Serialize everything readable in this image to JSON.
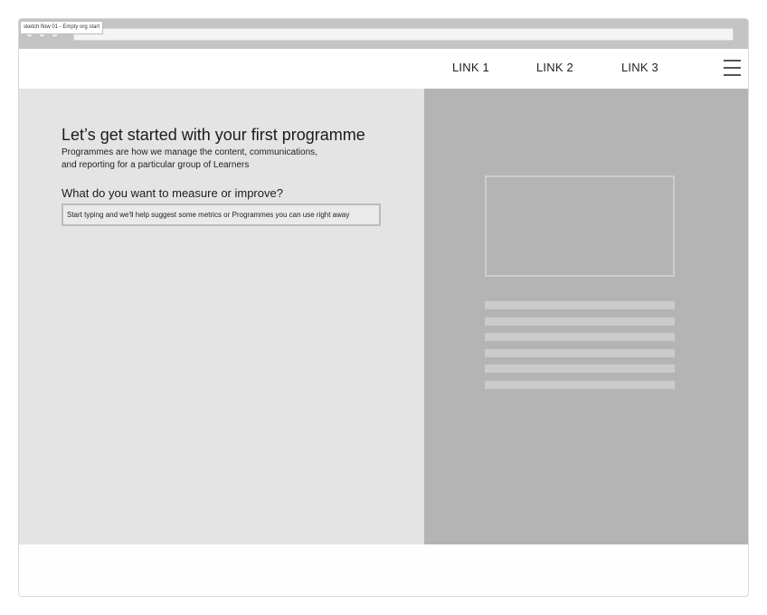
{
  "window": {
    "tab_title": "sketch flow 01 - Empty org start"
  },
  "nav": {
    "links": [
      "LINK 1",
      "LINK 2",
      "LINK 3"
    ],
    "menu_icon": "hamburger-menu-icon"
  },
  "main": {
    "heading": "Let’s get started with your first programme",
    "description": "Programmes are how we manage the content, communications, and reporting for a particular group of Learners",
    "question": "What do you want to measure or improve?",
    "search": {
      "placeholder": "Start typing and we'll help suggest some metrics or Programmes you can use right away",
      "value": ""
    }
  },
  "colors": {
    "left_panel": "#e4e4e4",
    "right_panel": "#b4b4b4",
    "browser_bar": "#c4c4c4"
  }
}
